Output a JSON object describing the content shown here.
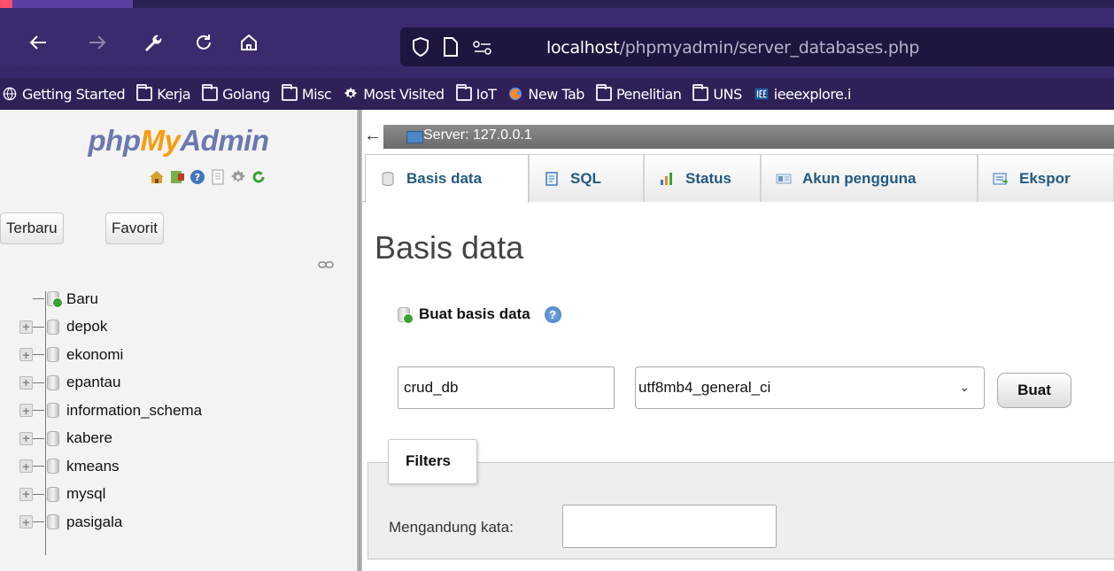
{
  "browser": {
    "url_host": "localhost",
    "url_path": "/phpmyadmin/server_databases.php",
    "bookmarks": [
      {
        "label": "Getting Started",
        "icon": "globe-icon"
      },
      {
        "label": "Kerja",
        "icon": "folder-icon"
      },
      {
        "label": "Golang",
        "icon": "folder-icon"
      },
      {
        "label": "Misc",
        "icon": "folder-icon"
      },
      {
        "label": "Most Visited",
        "icon": "gear-icon"
      },
      {
        "label": "IoT",
        "icon": "folder-icon"
      },
      {
        "label": "New Tab",
        "icon": "firefox-icon"
      },
      {
        "label": "Penelitian",
        "icon": "folder-icon"
      },
      {
        "label": "UNS",
        "icon": "folder-icon"
      },
      {
        "label": "ieeexplore.i",
        "icon": "ieee-icon"
      }
    ]
  },
  "sidebar": {
    "logo": {
      "php": "php",
      "my": "My",
      "admin": "Admin"
    },
    "buttons": {
      "recent": "Terbaru",
      "favorites": "Favorit"
    },
    "new_label": "Baru",
    "databases": [
      "depok",
      "ekonomi",
      "epantau",
      "information_schema",
      "kabere",
      "kmeans",
      "mysql",
      "pasigala"
    ]
  },
  "main": {
    "server_label": "Server: 127.0.0.1",
    "tabs": [
      {
        "label": "Basis data",
        "active": true
      },
      {
        "label": "SQL",
        "active": false
      },
      {
        "label": "Status",
        "active": false
      },
      {
        "label": "Akun pengguna",
        "active": false
      },
      {
        "label": "Ekspor",
        "active": false
      }
    ],
    "page_title": "Basis data",
    "create": {
      "heading": "Buat basis data",
      "db_name_value": "crud_db",
      "collation_value": "utf8mb4_general_ci",
      "submit_label": "Buat"
    },
    "filters": {
      "legend": "Filters",
      "contains_label": "Mengandung kata:",
      "contains_value": ""
    }
  },
  "colors": {
    "browser_bg": "#3b2a6e",
    "pma_link_blue": "#235a81",
    "logo_blue": "#6c78af",
    "logo_orange": "#f89c0e"
  }
}
